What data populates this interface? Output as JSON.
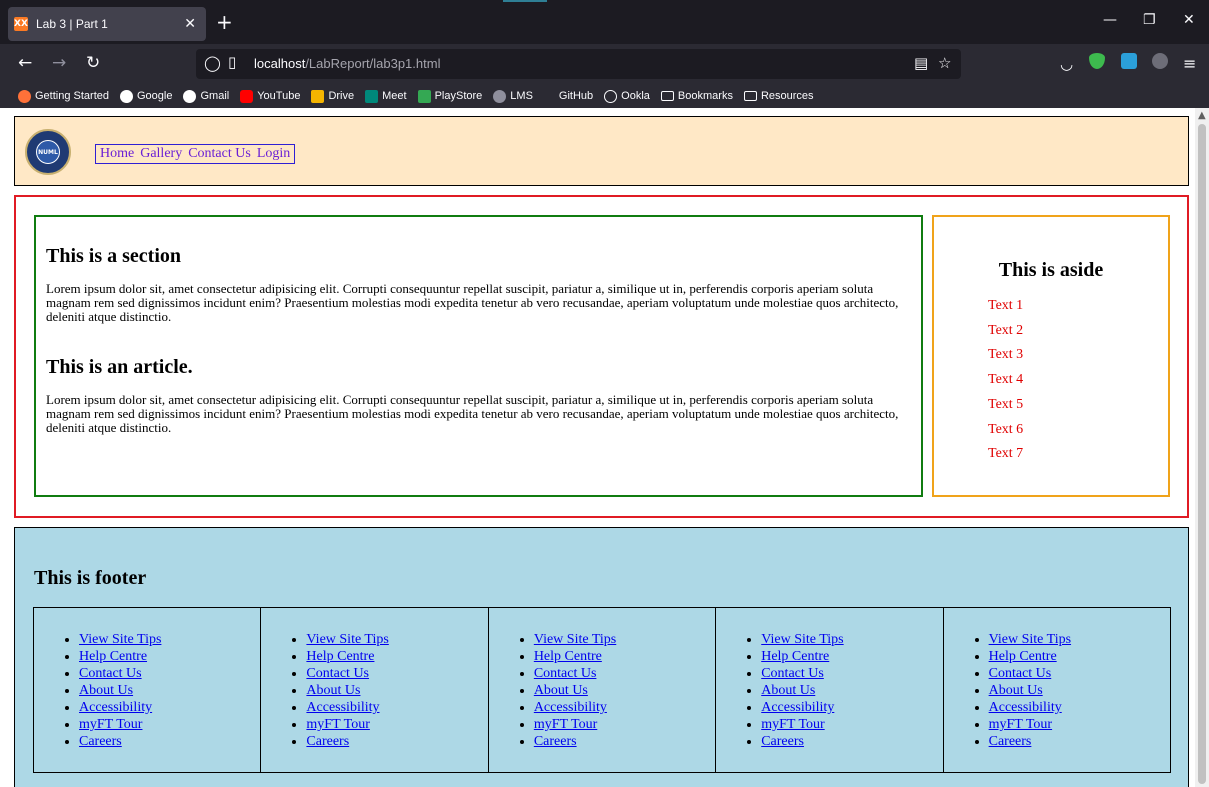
{
  "browser": {
    "tab_title": "Lab 3 | Part 1",
    "tab_favicon_text": "XX",
    "url_host": "localhost",
    "url_path": "/LabReport/lab3p1.html",
    "bookmarks": [
      "Getting Started",
      "Google",
      "Gmail",
      "YouTube",
      "Drive",
      "Meet",
      "PlayStore",
      "LMS",
      "GitHub",
      "Ookla",
      "Bookmarks",
      "Resources"
    ]
  },
  "header": {
    "logo_text": "NUML",
    "nav": [
      "Home",
      "Gallery",
      "Contact Us",
      "Login"
    ]
  },
  "section": {
    "heading": "This is a section",
    "paragraph": "Lorem ipsum dolor sit, amet consectetur adipisicing elit. Corrupti consequuntur repellat suscipit, pariatur a, similique ut in, perferendis corporis aperiam soluta magnam rem sed dignissimos incidunt enim? Praesentium molestias modi expedita tenetur ab vero recusandae, aperiam voluptatum unde molestiae quos architecto, deleniti atque distinctio.",
    "article_heading": "This is an article.",
    "article_paragraph": "Lorem ipsum dolor sit, amet consectetur adipisicing elit. Corrupti consequuntur repellat suscipit, pariatur a, similique ut in, perferendis corporis aperiam soluta magnam rem sed dignissimos incidunt enim? Praesentium molestias modi expedita tenetur ab vero recusandae, aperiam voluptatum unde molestiae quos architecto, deleniti atque distinctio."
  },
  "aside": {
    "heading": "This is aside",
    "items": [
      "Text 1",
      "Text 2",
      "Text 3",
      "Text 4",
      "Text 5",
      "Text 6",
      "Text 7"
    ]
  },
  "footer": {
    "heading": "This is footer",
    "columns": [
      [
        "View Site Tips",
        "Help Centre",
        "Contact Us",
        "About Us",
        "Accessibility",
        "myFT Tour",
        "Careers"
      ],
      [
        "View Site Tips",
        "Help Centre",
        "Contact Us",
        "About Us",
        "Accessibility",
        "myFT Tour",
        "Careers"
      ],
      [
        "View Site Tips",
        "Help Centre",
        "Contact Us",
        "About Us",
        "Accessibility",
        "myFT Tour",
        "Careers"
      ],
      [
        "View Site Tips",
        "Help Centre",
        "Contact Us",
        "About Us",
        "Accessibility",
        "myFT Tour",
        "Careers"
      ],
      [
        "View Site Tips",
        "Help Centre",
        "Contact Us",
        "About Us",
        "Accessibility",
        "myFT Tour",
        "Careers"
      ]
    ]
  },
  "colors": {
    "header_bg": "#ffe8c6",
    "main_border": "#e01b24",
    "section_border": "#107c10",
    "aside_border": "#f0a31a",
    "aside_text": "#e00000",
    "footer_bg": "#add8e6",
    "link": "#0000ee"
  }
}
